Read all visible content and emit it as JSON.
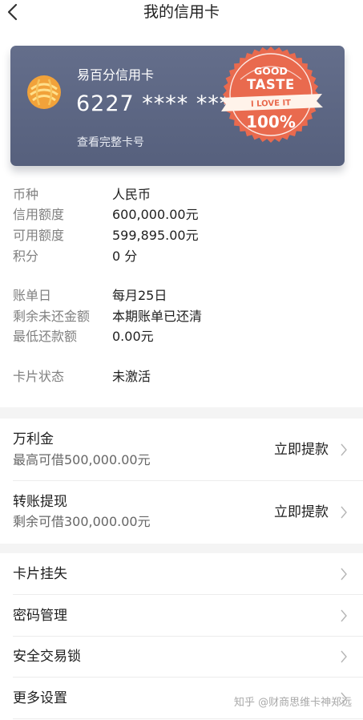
{
  "header": {
    "title": "我的信用卡",
    "back_icon": "chevron-left-icon"
  },
  "card": {
    "name": "易百分信用卡",
    "number": "6227 **** ***",
    "view_full_number": "查看完整卡号",
    "logo_icon": "bank-logo-icon",
    "background_color": "#5c6683"
  },
  "sticker": {
    "top": "GOOD",
    "main": "TASTE",
    "ribbon": "I LOVE IT",
    "bottom": "100%",
    "color": "#e96a4e"
  },
  "info": {
    "rows": [
      {
        "label": "币种",
        "value": "人民币"
      },
      {
        "label": "信用额度",
        "value": "600,000.00元"
      },
      {
        "label": "可用额度",
        "value": "599,895.00元"
      },
      {
        "label": "积分",
        "value": "0 分"
      },
      {
        "label": "账单日",
        "value": "每月25日"
      },
      {
        "label": "剩余未还金额",
        "value": "本期账单已还清"
      },
      {
        "label": "最低还款额",
        "value": "0.00元"
      },
      {
        "label": "卡片状态",
        "value": "未激活"
      }
    ]
  },
  "loans": [
    {
      "title": "万利金",
      "subtitle": "最高可借500,000.00元",
      "action": "立即提款"
    },
    {
      "title": "转账提现",
      "subtitle": "剩余可借300,000.00元",
      "action": "立即提款"
    }
  ],
  "menu": [
    {
      "label": "卡片挂失"
    },
    {
      "label": "密码管理"
    },
    {
      "label": "安全交易锁"
    },
    {
      "label": "更多设置"
    }
  ],
  "row_arrow_icon": "chevron-right-icon",
  "watermark": "知乎 @财商思维卡神郑远"
}
